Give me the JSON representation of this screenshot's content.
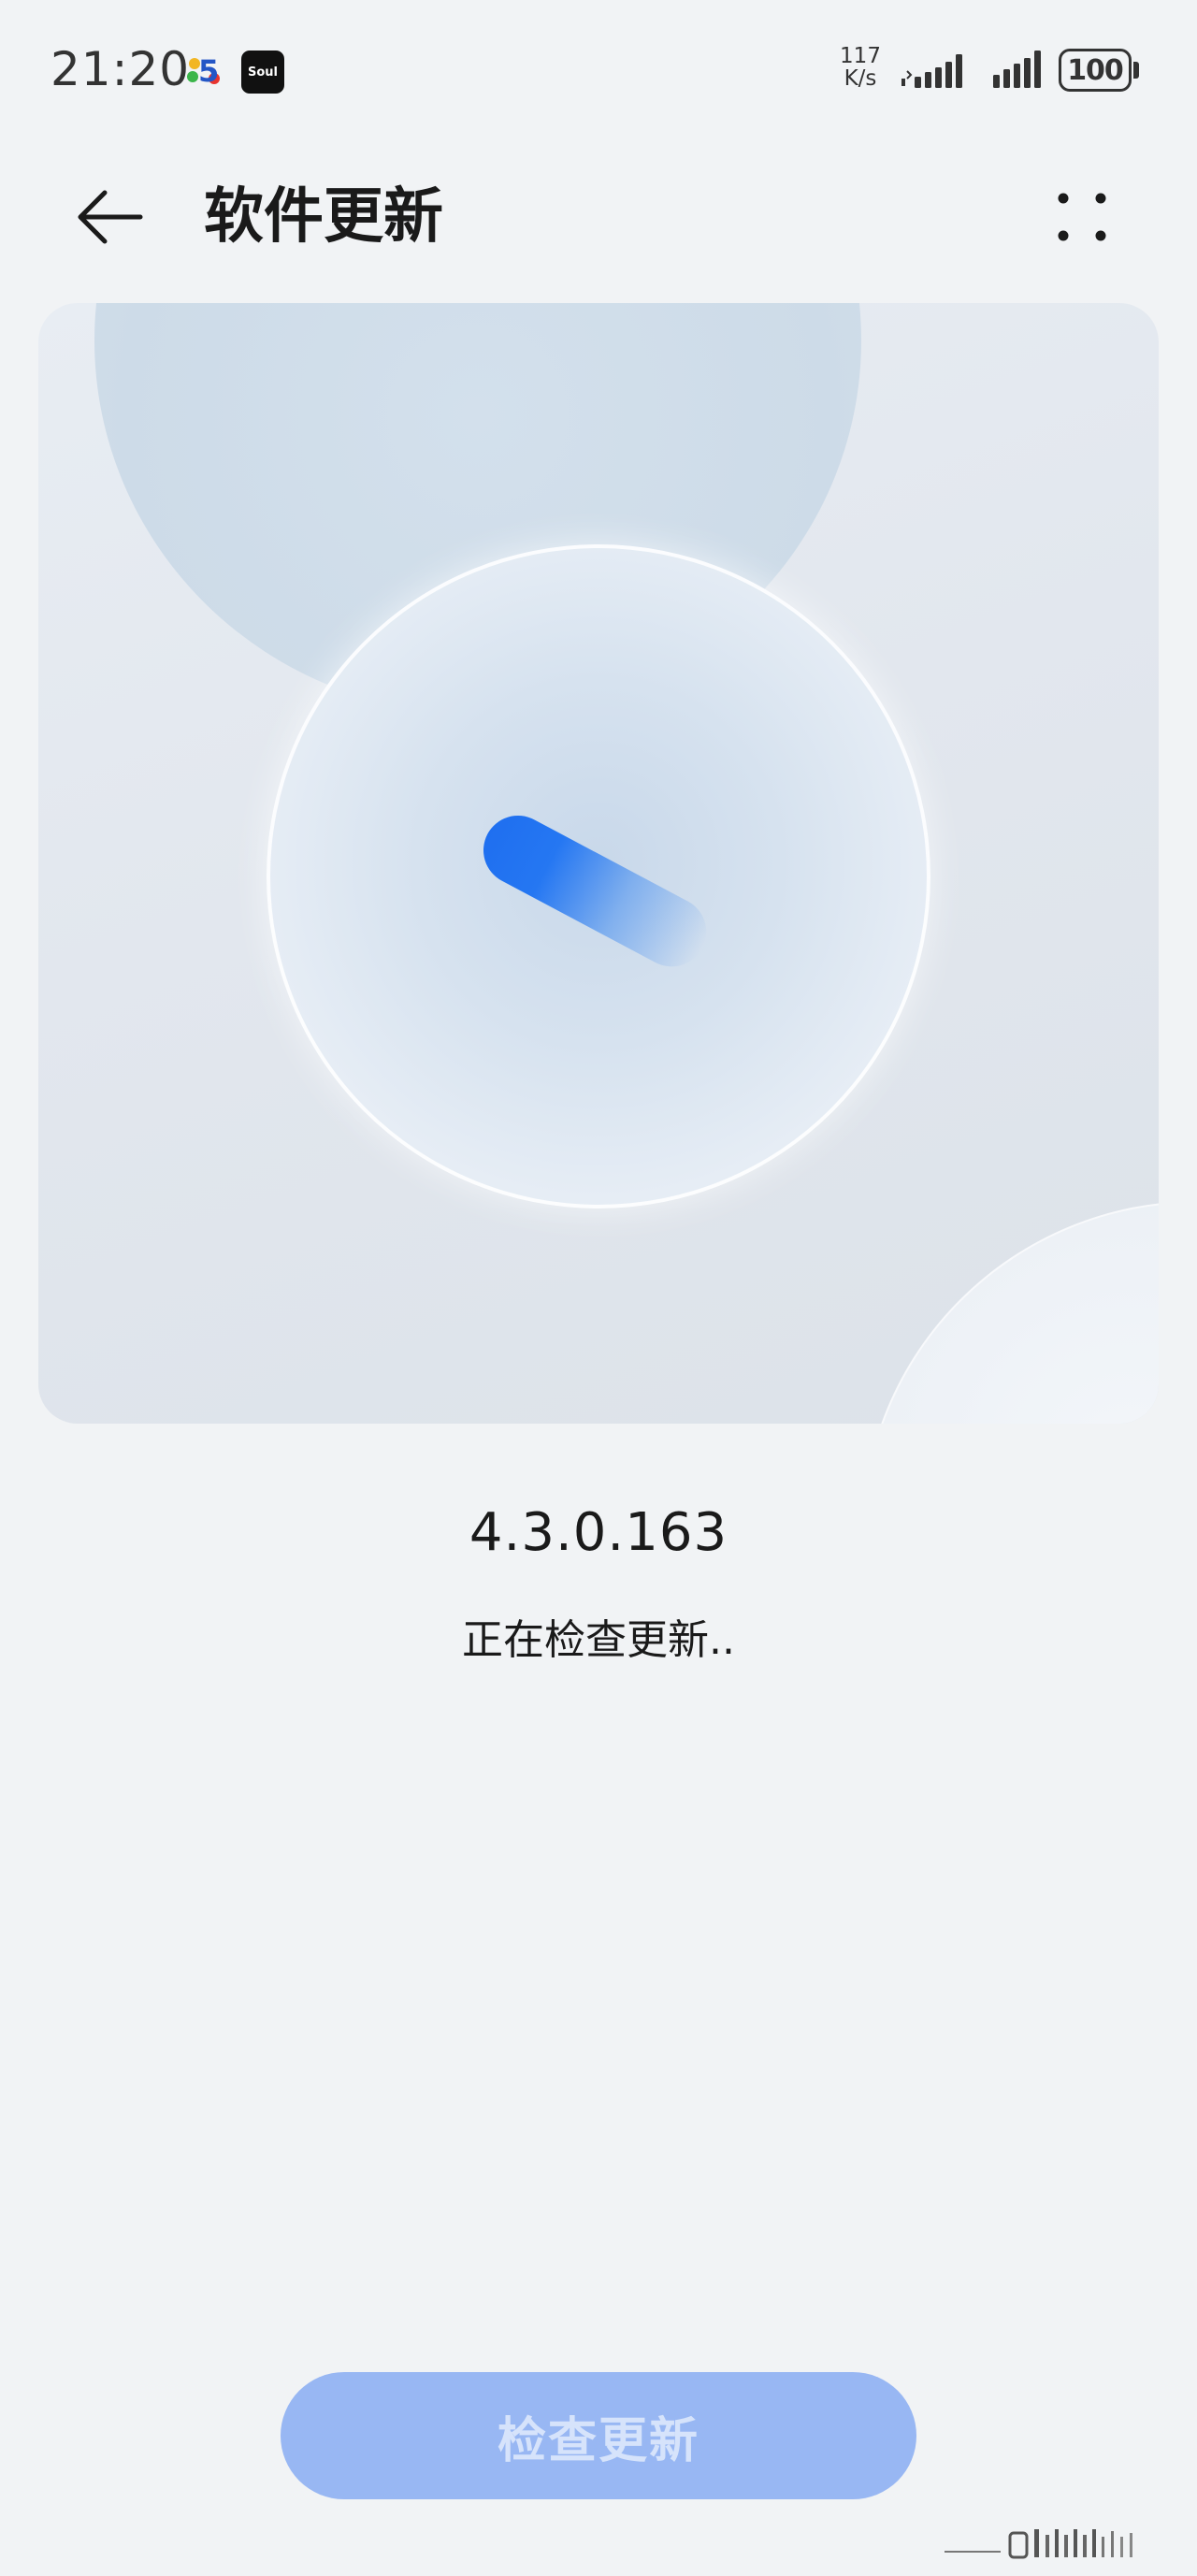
{
  "status_bar": {
    "time": "21:20",
    "net_speed_value": "117",
    "net_speed_unit": "K/s",
    "battery": "100",
    "soul_app_label": "Soul"
  },
  "header": {
    "title": "软件更新",
    "back_icon": "arrow-left-icon",
    "more_icon": "more-dots-icon"
  },
  "version": {
    "number": "4.3.0.163",
    "status": "正在检查更新.."
  },
  "actions": {
    "check_update_label": "检查更新"
  },
  "colors": {
    "background": "#f1f3f5",
    "accent": "#1f6ff0",
    "button_disabled_bg": "#98b7f3",
    "button_disabled_text": "#d6e3fb"
  }
}
